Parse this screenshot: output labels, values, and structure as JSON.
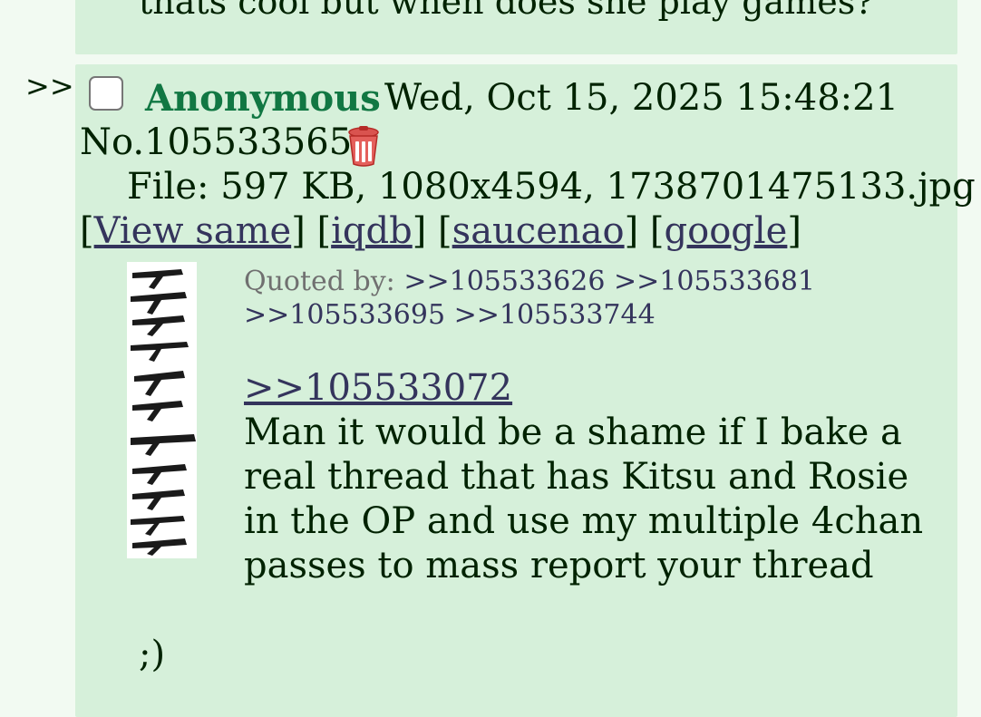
{
  "previous_post": {
    "text_fragment": "thats cool but when does she play games?"
  },
  "post": {
    "side_arrows": ">>",
    "name": "Anonymous",
    "datetime": "Wed, Oct 15, 2025 15:48:21",
    "number": "No.105533565",
    "file": "File: 597 KB, 1080x4594, 1738701475133.jpg",
    "links": {
      "view_same": "View same",
      "iqdb": "iqdb",
      "saucenao": "saucenao",
      "google": "google"
    },
    "quoted_by_label": "Quoted by:",
    "quoted_by": [
      ">>105533626",
      ">>105533681",
      ">>105533695",
      ">>105533744"
    ],
    "reply_to": ">>105533072",
    "message": "Man it would be a shame if I bake a real thread that has Kitsu and Rosie in the OP and use my multiple 4chan passes to mass report your thread",
    "closing": ";)"
  },
  "icons": {
    "delete": "trash-icon"
  },
  "colors": {
    "name": "#117743",
    "link": "#34345c",
    "post_bg": "#d6f0da",
    "page_bg": "#f2faf2"
  }
}
